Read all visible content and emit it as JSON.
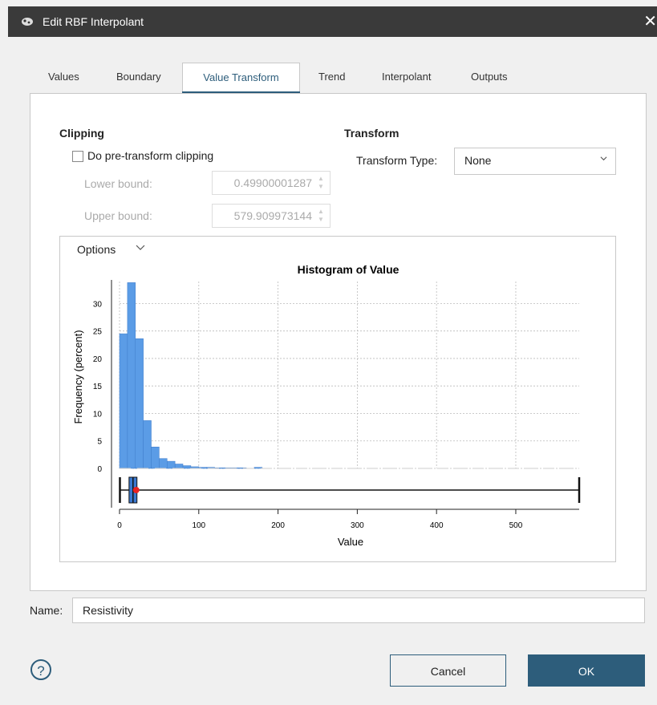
{
  "window": {
    "title": "Edit RBF Interpolant",
    "close_glyph": "✕"
  },
  "tabs": [
    {
      "label": "Values",
      "active": false
    },
    {
      "label": "Boundary",
      "active": false
    },
    {
      "label": "Value Transform",
      "active": true
    },
    {
      "label": "Trend",
      "active": false
    },
    {
      "label": "Interpolant",
      "active": false
    },
    {
      "label": "Outputs",
      "active": false
    }
  ],
  "clipping": {
    "title": "Clipping",
    "checkbox_label": "Do pre-transform clipping",
    "checked": false,
    "lower_label": "Lower bound:",
    "lower_value": "0.49900001287",
    "upper_label": "Upper bound:",
    "upper_value": "579.909973144"
  },
  "transform": {
    "title": "Transform",
    "type_label": "Transform Type:",
    "type_value": "None"
  },
  "chart_options": {
    "label": "Options"
  },
  "chart_data": {
    "type": "bar",
    "title": "Histogram of Value",
    "xlabel": "Value",
    "ylabel": "Frequency (percent)",
    "xlim": [
      0,
      580
    ],
    "ylim": [
      0,
      34
    ],
    "xticks": [
      0,
      100,
      200,
      300,
      400,
      500
    ],
    "yticks": [
      0,
      5,
      10,
      15,
      20,
      25,
      30
    ],
    "bin_width": 10,
    "bins_start": [
      0,
      10,
      20,
      30,
      40,
      50,
      60,
      70,
      80,
      90,
      100,
      110,
      120,
      130,
      140,
      150,
      170
    ],
    "values": [
      24.5,
      33.8,
      23.6,
      8.7,
      3.9,
      1.8,
      1.3,
      0.8,
      0.5,
      0.3,
      0.2,
      0.2,
      0.1,
      0.1,
      0.1,
      0.1,
      0.2
    ],
    "boxplot": {
      "min": 0.5,
      "q1": 12,
      "median": 17,
      "q3": 22,
      "max": 580,
      "mean": 21
    },
    "grid": true,
    "bar_color": "#5b9ce6"
  },
  "name_field": {
    "label": "Name:",
    "value": "Resistivity"
  },
  "buttons": {
    "cancel": "Cancel",
    "ok": "OK",
    "help": "?"
  },
  "colors": {
    "accent": "#2d5d7b",
    "titlebar": "#3a3a3a"
  }
}
